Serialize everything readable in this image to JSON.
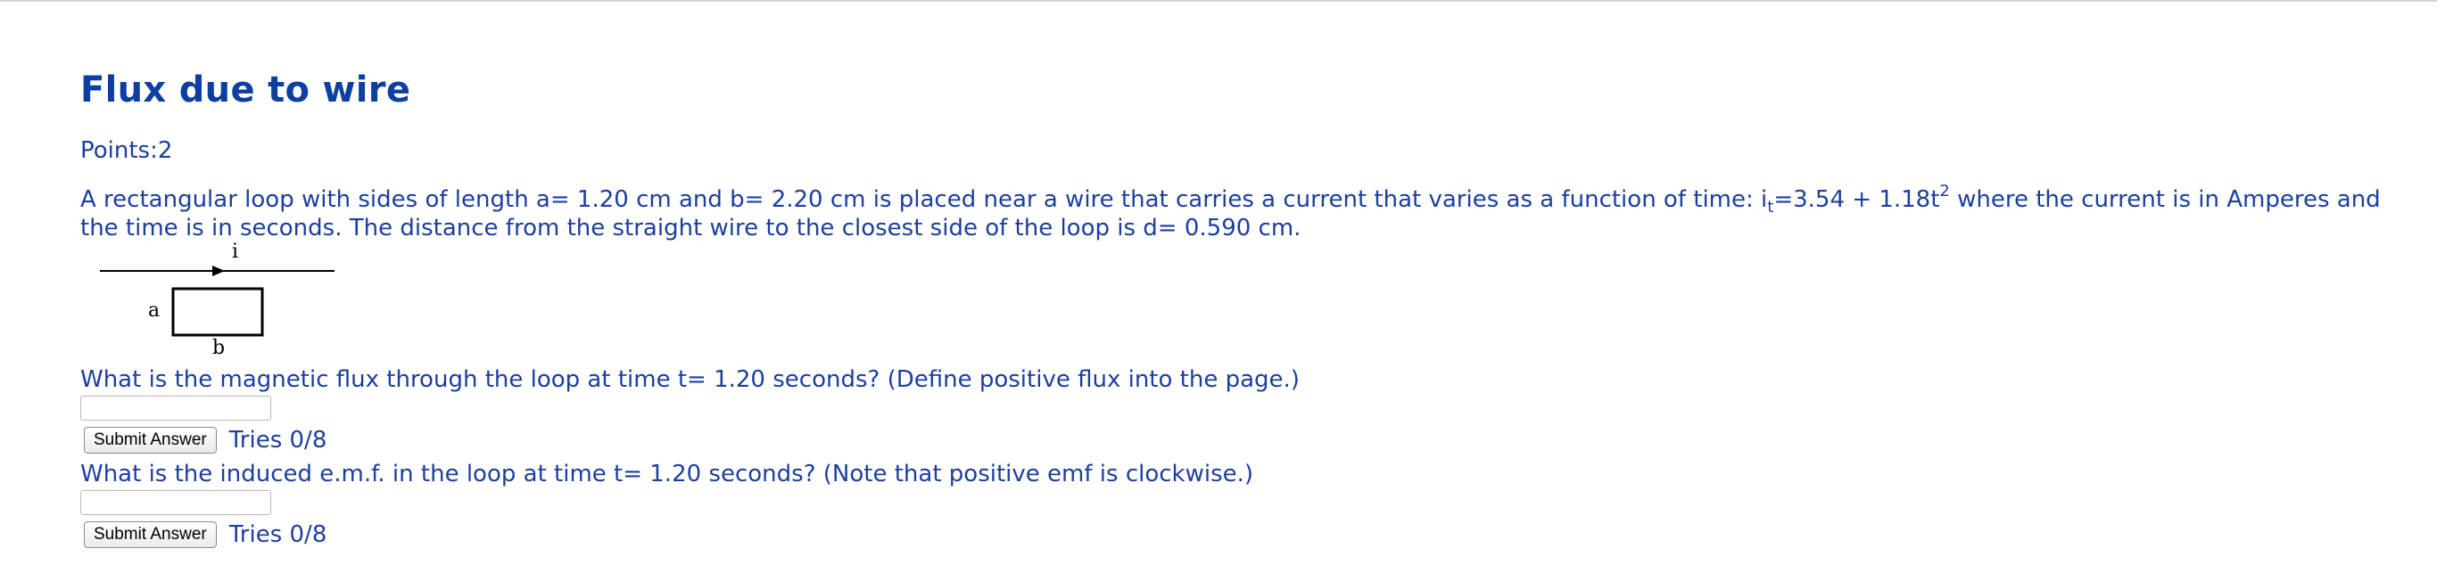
{
  "problem": {
    "title": "Flux due to wire",
    "points": "Points:2",
    "text_part1": "A rectangular loop with sides of length a= 1.20 cm and b= 2.20 cm is placed near a wire that carries a current that varies as a function of time: i",
    "current_sub": "t",
    "text_part2": "=3.54 + 1.18t",
    "current_sup": "2",
    "text_part3": " where the current is in Amperes and the time is in seconds. The distance from the straight wire to the closest side of the loop is d= 0.590 cm."
  },
  "figure": {
    "label_i": "i",
    "label_a": "a",
    "label_b": "b"
  },
  "questions": [
    {
      "prompt": "What is the magnetic flux through the loop at time t= 1.20 seconds? (Define positive flux into the page.)",
      "answer_value": "",
      "submit_label": "Submit Answer",
      "tries": "Tries 0/8"
    },
    {
      "prompt": "What is the induced e.m.f. in the loop at time t= 1.20 seconds? (Note that positive emf is clockwise.)",
      "answer_value": "",
      "submit_label": "Submit Answer",
      "tries": "Tries 0/8"
    }
  ]
}
